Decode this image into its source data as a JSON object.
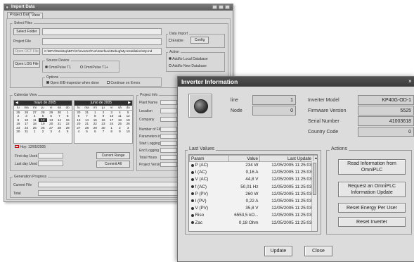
{
  "import_window": {
    "title": "Import Data",
    "tabs": [
      "Project Data",
      "View"
    ],
    "select_files_group": "Select Files",
    "select_folder_label": "Select Folder",
    "project_file_label": "Project File",
    "open_file_label": "Open OCT File",
    "path_value": "C:\\BPV\\Desktop\\BPV\\C\\Inverter\\Fun\\Interface\\Debug\\My.Installation\\My.Ind",
    "open_log_label": "Open LOG File",
    "data_import_group": "Data Import",
    "enable_label": "Enable",
    "config_label": "Config",
    "actions_group": "Action",
    "action_options": [
      "Add/to Local Database",
      "Add/to New Database"
    ],
    "source_group": "Source Device",
    "source_options": [
      "OmniPulse T1",
      "OmniPulse T1+"
    ],
    "options_group": "Options",
    "option_1": "Open EIB-inspector when done",
    "option_2": "Continue on Errors",
    "calendar_group": "Calendar View",
    "calendars": [
      {
        "month": "mayo de 2005",
        "days_header": [
          "lu",
          "ma",
          "mi",
          "ju",
          "vi",
          "sá",
          "do"
        ],
        "days": [
          "25",
          "26",
          "27",
          "28",
          "29",
          "30",
          "1",
          "2",
          "3",
          "4",
          "5",
          "6",
          "7",
          "8",
          "9",
          "10",
          "11",
          "12",
          "13",
          "14",
          "15",
          "16",
          "17",
          "18",
          "19",
          "20",
          "21",
          "22",
          "23",
          "24",
          "25",
          "26",
          "27",
          "28",
          "29",
          "30",
          "31",
          "1",
          "2",
          "3",
          "4",
          "5"
        ]
      },
      {
        "month": "junio de 2005",
        "days_header": [
          "lu",
          "ma",
          "mi",
          "ju",
          "vi",
          "sá",
          "do"
        ],
        "days": [
          "30",
          "31",
          "1",
          "2",
          "3",
          "4",
          "5",
          "6",
          "7",
          "8",
          "9",
          "10",
          "11",
          "12",
          "13",
          "14",
          "15",
          "16",
          "17",
          "18",
          "19",
          "20",
          "21",
          "22",
          "23",
          "24",
          "25",
          "26",
          "27",
          "28",
          "29",
          "30",
          "1",
          "2",
          "3",
          "4",
          "5",
          "6",
          "7",
          "8",
          "9",
          "10"
        ]
      }
    ],
    "today_label": "Hoy: 12/05/2005",
    "first_day_label": "First day Used",
    "last_day_label": "Last day Used",
    "current_range_label": "Current Range",
    "commit_label": "Commit All",
    "project_info_group": "Project Info",
    "project_info_labels": [
      "Plant Name",
      "Location",
      "Company",
      "Number of Files",
      "Parameters in Log",
      "Start Logging Time",
      "End Logging Time",
      "Total Hours",
      "Project Version"
    ],
    "progress_group": "Generation Progress",
    "current_file_label": "Current File",
    "total_label": "Total"
  },
  "inverter_window": {
    "title": "Inverter Information",
    "line_label": "line",
    "line_value": "1",
    "node_label": "Node",
    "node_value": "0",
    "info_rows": [
      {
        "label": "Inverter Model",
        "value": "KP40G-OD-1"
      },
      {
        "label": "Firmware Version",
        "value": "5525"
      },
      {
        "label": "Serial Number",
        "value": "41003618"
      },
      {
        "label": "Country Code",
        "value": "0"
      }
    ],
    "last_values_group": "Last Values",
    "columns": [
      "Param",
      "Value",
      "Last Update"
    ],
    "rows": [
      {
        "param": "P (AC)",
        "value": "234 W",
        "update": "12/05/2005 11:25:03"
      },
      {
        "param": "I (AC)",
        "value": "0,16 A",
        "update": "12/05/2005 11:25:03"
      },
      {
        "param": "V (AC)",
        "value": "44,8 V",
        "update": "12/05/2005 11:25:03"
      },
      {
        "param": "f (AC)",
        "value": "50,01 Hz",
        "update": "12/05/2005 11:25:03"
      },
      {
        "param": "P (PV)",
        "value": "260 W",
        "update": "12/05/2005 11:25:03"
      },
      {
        "param": "I (PV)",
        "value": "0,22 A",
        "update": "12/05/2005 11:25:03"
      },
      {
        "param": "V (PV)",
        "value": "35,8 V",
        "update": "12/05/2005 11:25:03"
      },
      {
        "param": "Riso",
        "value": "6553,5 kO...",
        "update": "12/05/2005 11:25:03"
      },
      {
        "param": "Zac",
        "value": "0,18 Ohm",
        "update": "12/05/2005 11:25:03"
      }
    ],
    "actions_group": "Actions",
    "actions": [
      "Read Information from OmniPLC",
      "Request an OmniPLC Information Update",
      "Reset Energy Per User",
      "Reset Inverter"
    ],
    "update_label": "Update",
    "close_label": "Close"
  }
}
